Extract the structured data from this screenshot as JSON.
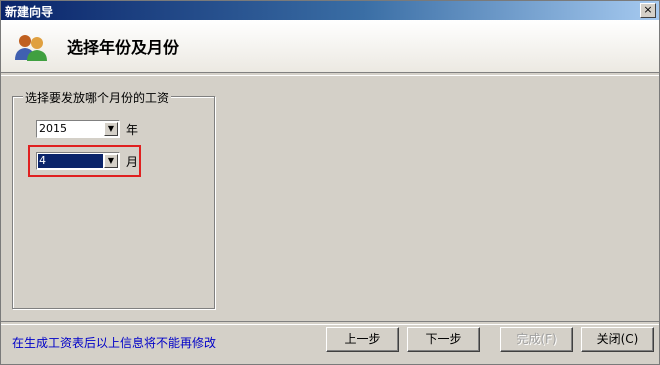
{
  "window": {
    "title": "新建向导",
    "close_glyph": "×"
  },
  "header": {
    "icon": "users-icon",
    "title": "选择年份及月份"
  },
  "group": {
    "legend": "选择要发放哪个月份的工资",
    "year": {
      "value": "2015",
      "unit": "年"
    },
    "month": {
      "value": "4",
      "unit": "月"
    }
  },
  "footer": {
    "note": "在生成工资表后以上信息将不能再修改",
    "buttons": {
      "prev": "上一步",
      "next": "下一步",
      "finish": "完成(F)",
      "close": "关闭(C)"
    }
  },
  "colors": {
    "title_bar": "#0a246a",
    "note_text": "#0000c8",
    "highlight": "#e02020"
  }
}
